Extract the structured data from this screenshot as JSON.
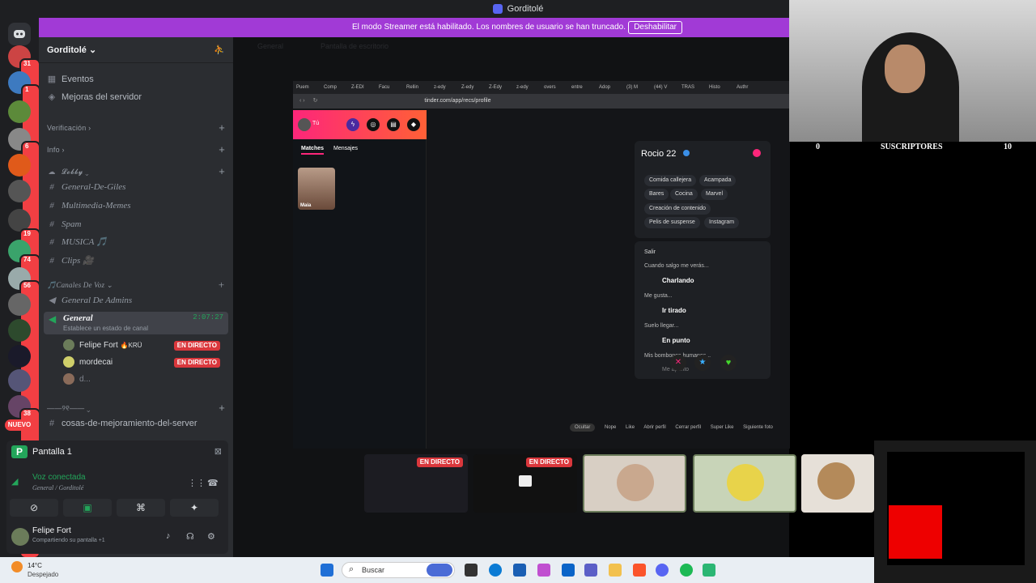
{
  "window": {
    "title": "Gorditolé"
  },
  "banner": {
    "text": "El modo Streamer está habilitado. Los nombres de usuario se han truncado.",
    "button": "Deshabilitar"
  },
  "guild_badges": [
    "31",
    "1",
    "6",
    "19",
    "74",
    "56",
    "38"
  ],
  "new_badge": "NUEVO",
  "server": {
    "name": "Gorditolé",
    "items": [
      {
        "icon": "calendar-icon",
        "label": "Eventos"
      },
      {
        "icon": "boost-icon",
        "label": "Mejoras del servidor"
      }
    ],
    "categories": [
      {
        "label": "Verificación",
        "chevron": "›"
      },
      {
        "label": "Info",
        "chevron": "›"
      },
      {
        "label": "𝓛𝓸𝓫𝓫𝔂",
        "chevron": "⌄"
      }
    ],
    "text_channels": [
      "General-De-Giles",
      "Multimedia-Memes",
      "Spam",
      "MUSICA 🎵",
      "Clips 🎥"
    ],
    "voice_category": "🎵Canales De Voz",
    "voice_channels": [
      {
        "label": "General De Admins"
      },
      {
        "label": "General",
        "time": "2:07:27",
        "status": "Establece un estado de canal"
      }
    ],
    "voice_users": [
      {
        "name": "Felipe Fort",
        "tag": "🔥KRÜ",
        "live": "EN DIRECTO"
      },
      {
        "name": "mordecai",
        "live": "EN DIRECTO"
      },
      {
        "name": "d..."
      }
    ],
    "divider_category": "——୨୧——",
    "bottom_channel": "cosas-de-mejoramiento-del-server"
  },
  "panel": {
    "screen_label": "Pantalla 1",
    "voice_status": "Voz conectada",
    "voice_location": "General / Gorditolé",
    "user_name": "Felipe Fort",
    "user_status": "Compartiendo su pantalla +1"
  },
  "main_header": {
    "label": "General",
    "sub": "Pantalla de escritorio"
  },
  "browser": {
    "tabs": [
      "Puem",
      "Comp",
      "Z-EDI",
      "Facu",
      "Rellin",
      "z-edy",
      "Z-edy",
      "Z-Edy",
      "z-edy",
      "overs",
      "entre",
      "Adop",
      "(3) M",
      "(44) V",
      "TRAS",
      "Histo",
      "Authr"
    ],
    "url": "tinder.com/app/recs/profile"
  },
  "tinder": {
    "user": "Tú",
    "tabs": [
      "Matches",
      "Mensajes"
    ],
    "match_name": "Maia",
    "profile_name": "Rocio 22",
    "interests": [
      "Comida callejera",
      "Acampada",
      "Bares",
      "Cocina",
      "Marvel",
      "Creación de contenido",
      "Pelis de suspense",
      "Instagram"
    ],
    "section_title": "Salir",
    "q1": "Cuando salgo me verás...",
    "a1": "Charlando",
    "q2": "Me gusta...",
    "a2": "Ir tirado",
    "q3": "Suelo llegar...",
    "a3": "En punto",
    "q4": "Mis bombones humanos...",
    "a4": "Me apunto"
  },
  "hints": [
    "Ocultar",
    "Nope",
    "Like",
    "Abrir perfil",
    "Cerrar perfil",
    "Super Like",
    "Siguiente foto"
  ],
  "webcam_stats": {
    "left": "0",
    "label": "SUSCRIPTORES",
    "right": "10"
  },
  "stream_thumbs": [
    {
      "live": "EN DIRECTO"
    },
    {
      "live": "EN DIRECTO"
    },
    {},
    {},
    {}
  ],
  "taskbar": {
    "weather_temp": "14°C",
    "weather_text": "Despejado",
    "search": "Buscar"
  }
}
